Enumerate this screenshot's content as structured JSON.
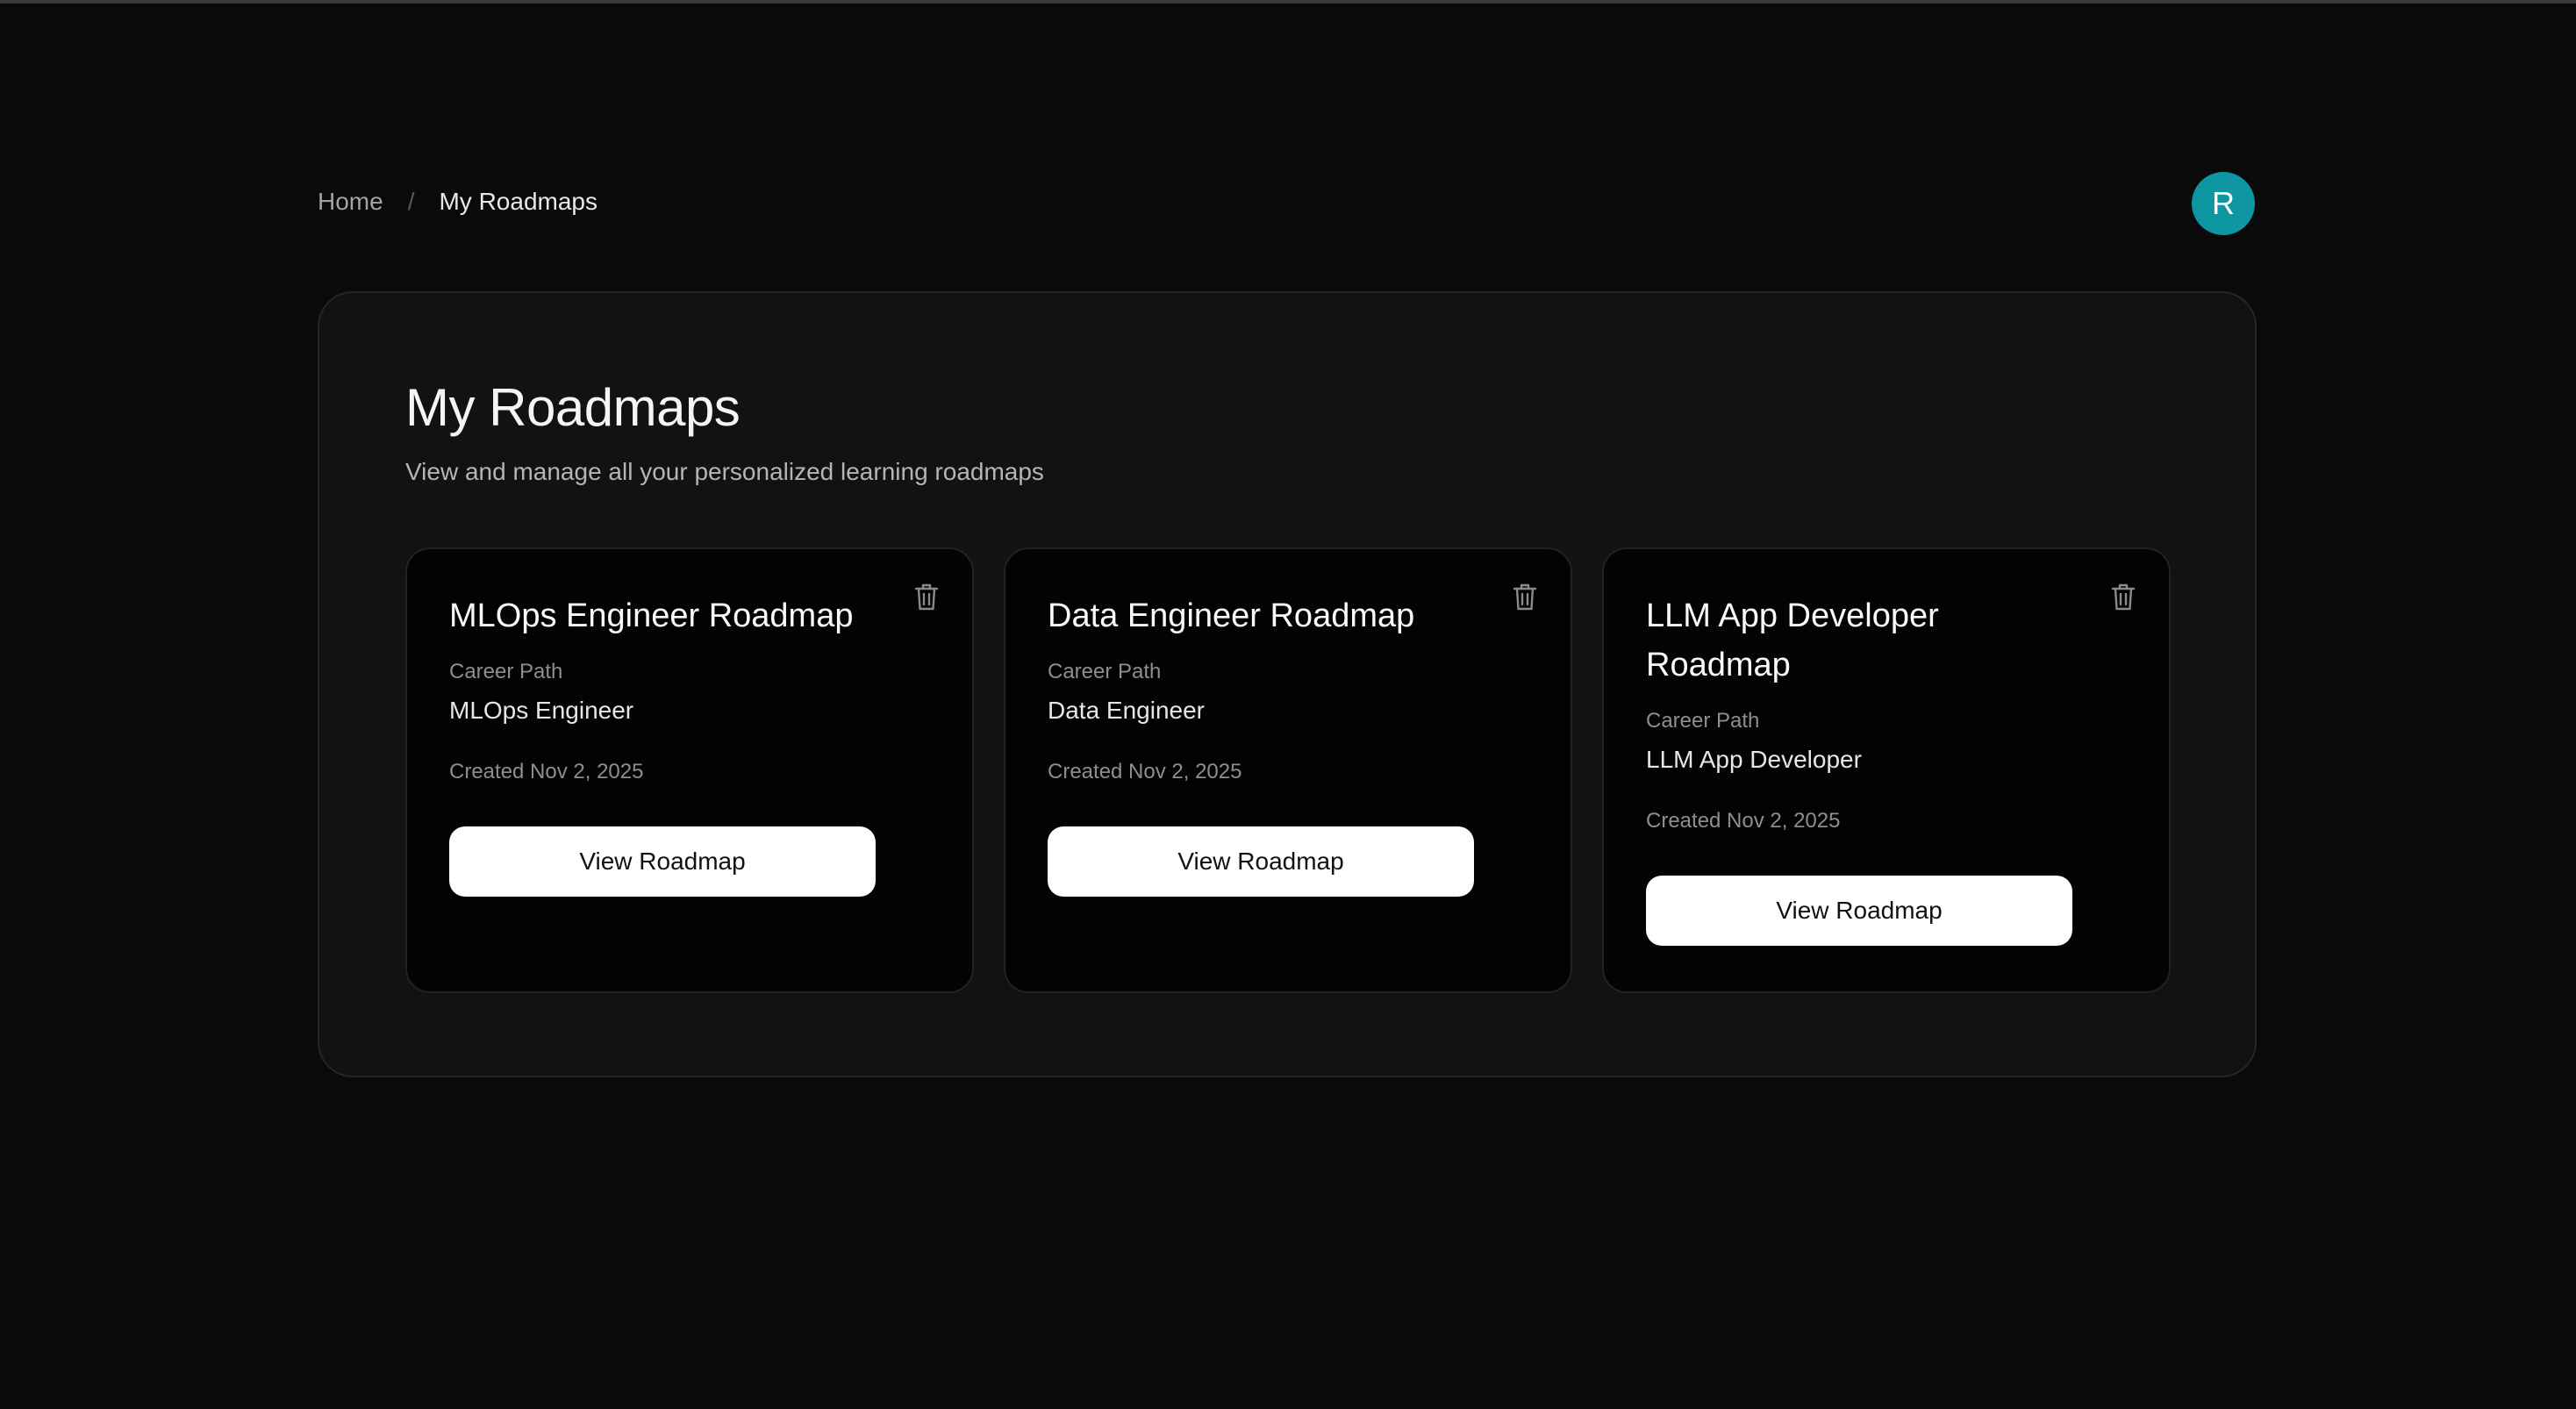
{
  "breadcrumb": {
    "home": "Home",
    "separator": "/",
    "current": "My Roadmaps"
  },
  "user": {
    "avatar_initial": "R",
    "avatar_color": "#0e97a3"
  },
  "page": {
    "title": "My Roadmaps",
    "subtitle": "View and manage all your personalized learning roadmaps"
  },
  "cards": [
    {
      "title": "MLOps Engineer Roadmap",
      "career_label": "Career Path",
      "career_value": "MLOps Engineer",
      "created": "Created Nov 2, 2025",
      "button_label": "View Roadmap",
      "delete_icon": "trash-icon"
    },
    {
      "title": "Data Engineer Roadmap",
      "career_label": "Career Path",
      "career_value": "Data Engineer",
      "created": "Created Nov 2, 2025",
      "button_label": "View Roadmap",
      "delete_icon": "trash-icon"
    },
    {
      "title": "LLM App Developer Roadmap",
      "career_label": "Career Path",
      "career_value": "LLM App Developer",
      "created": "Created Nov 2, 2025",
      "button_label": "View Roadmap",
      "delete_icon": "trash-icon"
    }
  ]
}
